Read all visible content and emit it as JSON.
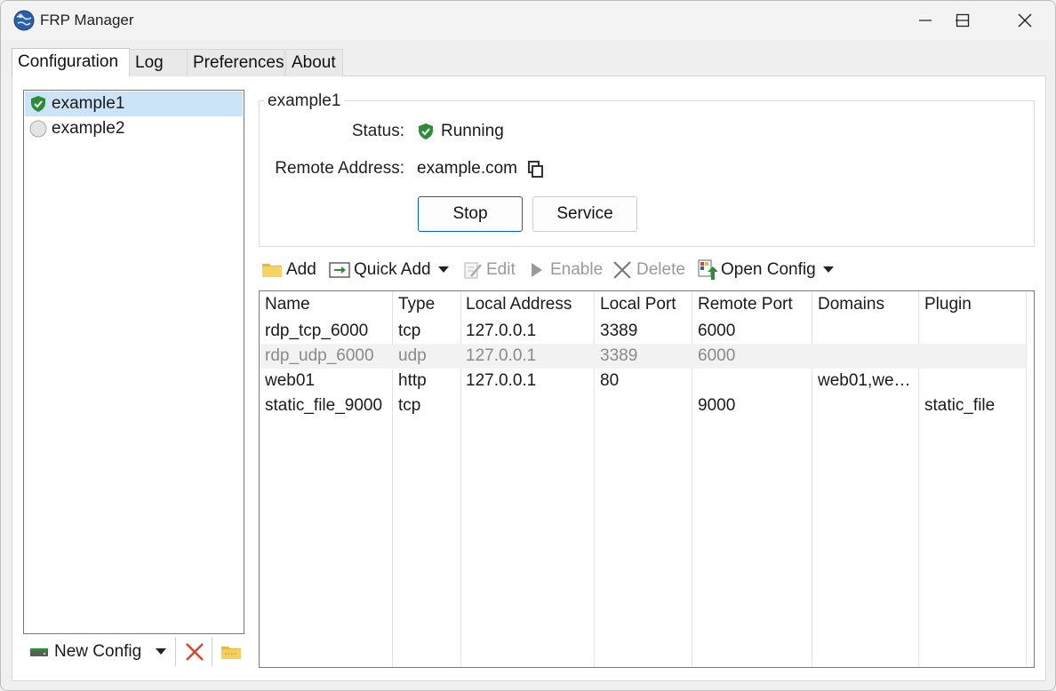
{
  "window": {
    "title": "FRP Manager"
  },
  "tabs": [
    {
      "label": "Configuration"
    },
    {
      "label": "Log"
    },
    {
      "label": "Preferences"
    },
    {
      "label": "About"
    }
  ],
  "configs": [
    {
      "name": "example1",
      "state": "running"
    },
    {
      "name": "example2",
      "state": "stopped"
    }
  ],
  "left_bottom": {
    "new_config_label": "New Config"
  },
  "detail": {
    "group_title": "example1",
    "status_label": "Status:",
    "status_value": "Running",
    "remote_label": "Remote Address:",
    "remote_value": "example.com",
    "stop_label": "Stop",
    "service_label": "Service"
  },
  "toolbar": {
    "add": "Add",
    "quick_add": "Quick Add",
    "edit": "Edit",
    "enable": "Enable",
    "delete": "Delete",
    "open_config": "Open Config"
  },
  "table": {
    "columns": [
      "Name",
      "Type",
      "Local Address",
      "Local Port",
      "Remote Port",
      "Domains",
      "Plugin"
    ],
    "rows": [
      {
        "cells": [
          "rdp_tcp_6000",
          "tcp",
          "127.0.0.1",
          "3389",
          "6000",
          "",
          ""
        ],
        "disabled": false
      },
      {
        "cells": [
          "rdp_udp_6000",
          "udp",
          "127.0.0.1",
          "3389",
          "6000",
          "",
          ""
        ],
        "disabled": true
      },
      {
        "cells": [
          "web01",
          "http",
          "127.0.0.1",
          "80",
          "",
          "web01,we…",
          ""
        ],
        "disabled": false
      },
      {
        "cells": [
          "static_file_9000",
          "tcp",
          "",
          "",
          "9000",
          "",
          "static_file"
        ],
        "disabled": false
      }
    ]
  },
  "colors": {
    "accent": "#0067c0",
    "selection": "#cce4f7",
    "running_green": "#2e8b3a"
  }
}
